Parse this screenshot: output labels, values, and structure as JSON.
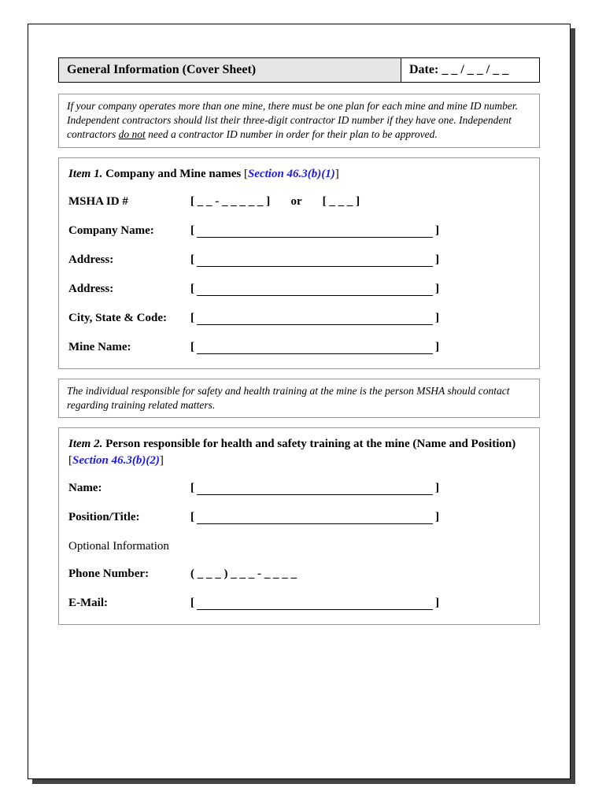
{
  "header": {
    "title": "General Information (Cover Sheet)",
    "date_label": "Date: _ _ / _ _ / _ _"
  },
  "note1": {
    "line1": "If your company operates more than one mine, there must be one plan for each mine and mine ID number.",
    "line2a": "Independent contractors should list their three-digit contractor ID number if they have one.  Independent",
    "line2b": "contractors ",
    "underlined": "do not",
    "line2c": " need a contractor ID number in order for their plan to be approved."
  },
  "item1": {
    "label": "Item 1.",
    "title": "Company and Mine names",
    "bracket_open": "[",
    "section": "Section 46.3(b)(1)",
    "bracket_close": "]",
    "msha_label": "MSHA ID #",
    "msha_value": "[ _ _ - _ _ _ _ _ ]       or       [ _ _ _ ]",
    "company_label": "Company Name:",
    "address_label": "Address:",
    "city_label": "City, State & Code:",
    "mine_label": "Mine Name:"
  },
  "note2": "The individual responsible for safety and health training at the mine is the person MSHA should contact regarding training related matters.",
  "item2": {
    "label": "Item 2.",
    "title": "Person responsible for health and safety training at the mine (Name and Position)",
    "bracket_open": "[",
    "section": "Section 46.3(b)(2)",
    "bracket_close": "]",
    "name_label": "Name:",
    "position_label": "Position/Title:",
    "optional": "Optional Information",
    "phone_label": "Phone Number:",
    "phone_value": "( _ _ _ ) _ _ _ - _ _ _ _",
    "email_label": "E-Mail:"
  },
  "brackets": {
    "open": "[",
    "close": "]"
  }
}
